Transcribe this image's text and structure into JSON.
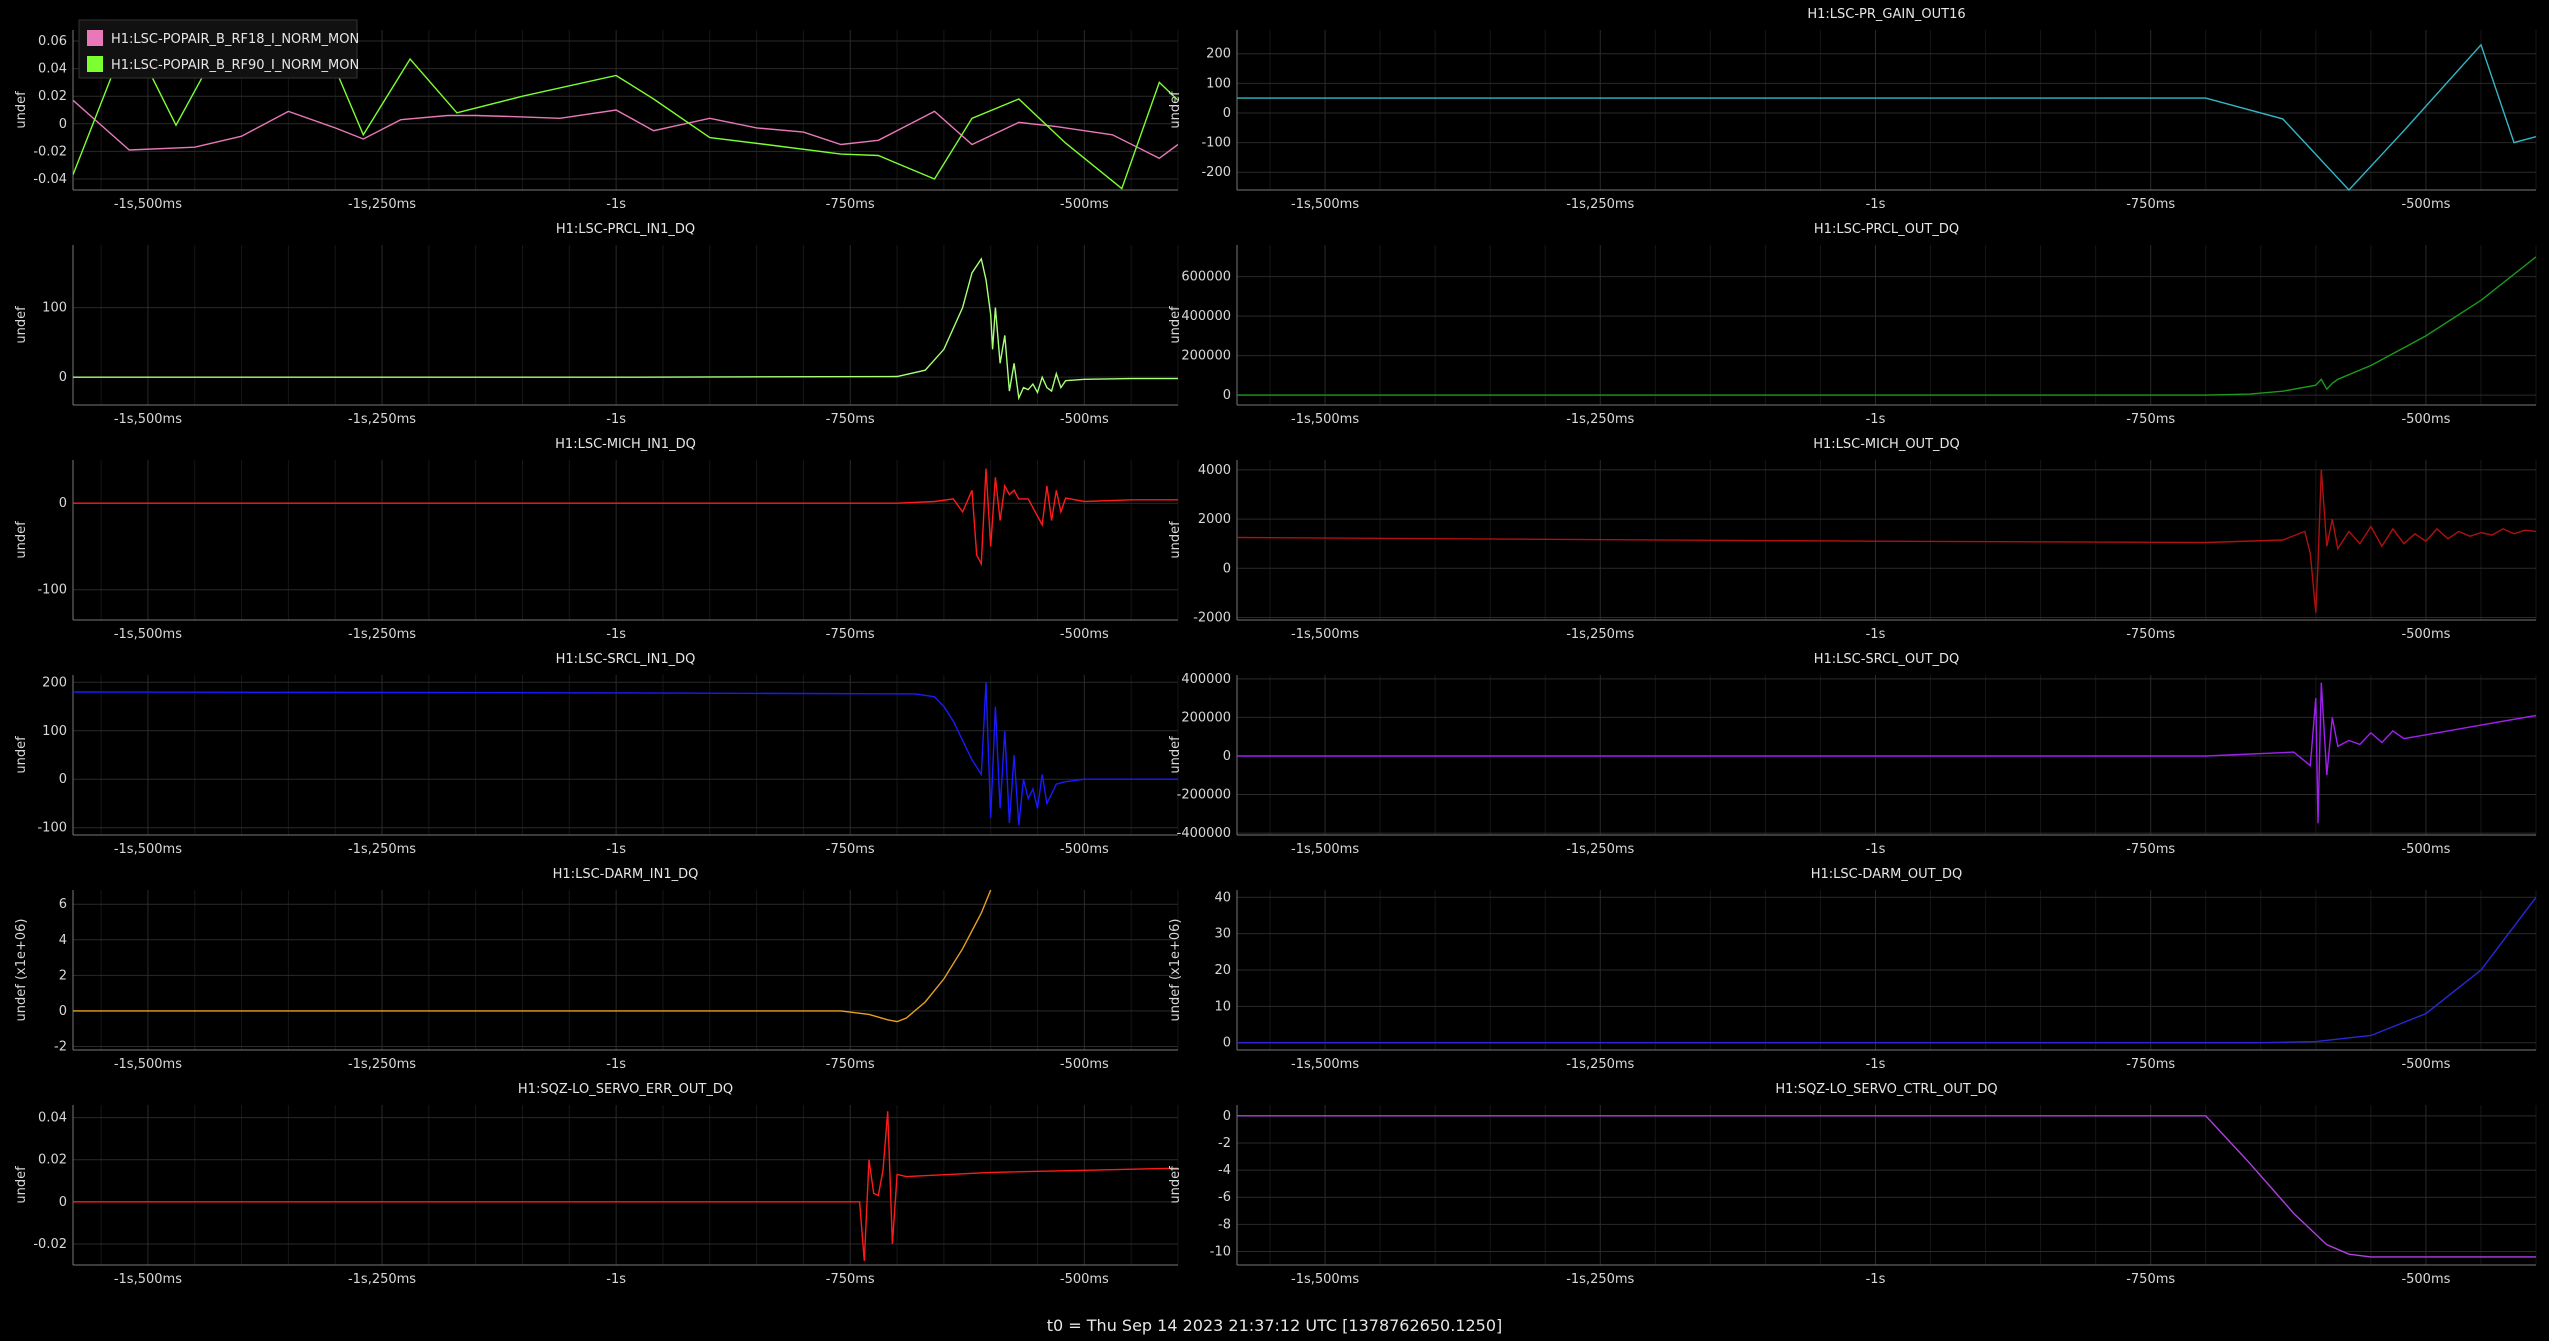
{
  "footer": "t0 = Thu Sep 14 2023 21:37:12 UTC [1378762650.1250]",
  "x_ticks": [
    {
      "v": -1.5,
      "label": "-1s,500ms"
    },
    {
      "v": -1.25,
      "label": "-1s,250ms"
    },
    {
      "v": -1.0,
      "label": "-1s"
    },
    {
      "v": -0.75,
      "label": "-750ms"
    },
    {
      "v": -0.5,
      "label": "-500ms"
    }
  ],
  "chart_data": [
    {
      "type": "line",
      "title": "",
      "ylabel": "undef",
      "xlim": [
        -1.58,
        -0.4
      ],
      "ylim": [
        -0.048,
        0.068
      ],
      "yticks": [
        {
          "v": 0.06,
          "label": "0.06"
        },
        {
          "v": 0.04,
          "label": "0.04"
        },
        {
          "v": 0.02,
          "label": "0.02"
        },
        {
          "v": 0,
          "label": "0"
        },
        {
          "v": -0.02,
          "label": "-0.02"
        },
        {
          "v": -0.04,
          "label": "-0.04"
        }
      ],
      "legend": "top-left",
      "series": [
        {
          "name": "H1:LSC-POPAIR_B_RF18_I_NORM_MON",
          "color": "#e878b8",
          "x": [
            -1.58,
            -1.52,
            -1.45,
            -1.4,
            -1.35,
            -1.3,
            -1.27,
            -1.23,
            -1.18,
            -1.15,
            -1.1,
            -1.06,
            -1.0,
            -0.96,
            -0.9,
            -0.85,
            -0.8,
            -0.76,
            -0.72,
            -0.66,
            -0.62,
            -0.57,
            -0.53,
            -0.47,
            -0.42,
            -0.4
          ],
          "y": [
            0.017,
            -0.019,
            -0.017,
            -0.009,
            0.009,
            -0.003,
            -0.011,
            0.003,
            0.006,
            0.006,
            0.005,
            0.004,
            0.01,
            -0.005,
            0.004,
            -0.003,
            -0.006,
            -0.015,
            -0.012,
            0.009,
            -0.015,
            0.001,
            -0.002,
            -0.008,
            -0.025,
            -0.015
          ]
        },
        {
          "name": "H1:LSC-POPAIR_B_RF90_I_NORM_MON",
          "color": "#7cff30",
          "x": [
            -1.58,
            -1.52,
            -1.47,
            -1.42,
            -1.35,
            -1.3,
            -1.27,
            -1.22,
            -1.17,
            -1.1,
            -1.0,
            -0.96,
            -0.9,
            -0.84,
            -0.76,
            -0.72,
            -0.66,
            -0.62,
            -0.57,
            -0.52,
            -0.46,
            -0.42,
            -0.4
          ],
          "y": [
            -0.037,
            0.067,
            -0.001,
            0.061,
            0.058,
            0.04,
            -0.008,
            0.047,
            0.008,
            0.02,
            0.035,
            0.018,
            -0.01,
            -0.015,
            -0.022,
            -0.023,
            -0.04,
            0.004,
            0.018,
            -0.014,
            -0.047,
            0.03,
            0.017
          ]
        }
      ]
    },
    {
      "type": "line",
      "title": "H1:LSC-PR_GAIN_OUT16",
      "ylabel": "undef",
      "xlim": [
        -1.58,
        -0.4
      ],
      "ylim": [
        -260,
        280
      ],
      "yticks": [
        {
          "v": 200,
          "label": "200"
        },
        {
          "v": 100,
          "label": "100"
        },
        {
          "v": 0,
          "label": "0"
        },
        {
          "v": -100,
          "label": "-100"
        },
        {
          "v": -200,
          "label": "-200"
        }
      ],
      "series": [
        {
          "name": "",
          "color": "#30b8c8",
          "x": [
            -1.58,
            -1.0,
            -0.7,
            -0.63,
            -0.57,
            -0.52,
            -0.45,
            -0.42,
            -0.4
          ],
          "y": [
            50,
            50,
            50,
            -20,
            -260,
            -60,
            230,
            -100,
            -80
          ]
        }
      ]
    },
    {
      "type": "line",
      "title": "H1:LSC-PRCL_IN1_DQ",
      "ylabel": "undef",
      "xlim": [
        -1.58,
        -0.4
      ],
      "ylim": [
        -40,
        190
      ],
      "yticks": [
        {
          "v": 100,
          "label": "100"
        },
        {
          "v": 0,
          "label": "0"
        }
      ],
      "series": [
        {
          "name": "",
          "color": "#a8ff78",
          "x": [
            -1.58,
            -1.0,
            -0.7,
            -0.67,
            -0.65,
            -0.63,
            -0.62,
            -0.61,
            -0.605,
            -0.6,
            -0.598,
            -0.595,
            -0.59,
            -0.585,
            -0.58,
            -0.575,
            -0.57,
            -0.565,
            -0.56,
            -0.555,
            -0.55,
            -0.545,
            -0.54,
            -0.535,
            -0.53,
            -0.525,
            -0.52,
            -0.5,
            -0.45,
            -0.4
          ],
          "y": [
            0,
            0,
            1,
            10,
            40,
            100,
            150,
            170,
            140,
            90,
            40,
            100,
            20,
            60,
            -20,
            20,
            -30,
            -15,
            -18,
            -10,
            -22,
            0,
            -15,
            -20,
            5,
            -15,
            -5,
            -3,
            -2,
            -2
          ]
        }
      ]
    },
    {
      "type": "line",
      "title": "H1:LSC-PRCL_OUT_DQ",
      "ylabel": "undef",
      "xlim": [
        -1.58,
        -0.4
      ],
      "ylim": [
        -50000,
        760000
      ],
      "yticks": [
        {
          "v": 600000,
          "label": "600000"
        },
        {
          "v": 400000,
          "label": "400000"
        },
        {
          "v": 200000,
          "label": "200000"
        },
        {
          "v": 0,
          "label": "0"
        }
      ],
      "series": [
        {
          "name": "",
          "color": "#1a9a1a",
          "x": [
            -1.58,
            -1.0,
            -0.7,
            -0.66,
            -0.63,
            -0.6,
            -0.595,
            -0.59,
            -0.585,
            -0.58,
            -0.55,
            -0.5,
            -0.45,
            -0.4
          ],
          "y": [
            0,
            0,
            0,
            5000,
            20000,
            50000,
            80000,
            30000,
            60000,
            80000,
            150000,
            300000,
            480000,
            700000
          ]
        }
      ]
    },
    {
      "type": "line",
      "title": "H1:LSC-MICH_IN1_DQ",
      "ylabel": "undef",
      "xlim": [
        -1.58,
        -0.4
      ],
      "ylim": [
        -135,
        50
      ],
      "yticks": [
        {
          "v": 0,
          "label": "0"
        },
        {
          "v": -100,
          "label": "-100"
        }
      ],
      "series": [
        {
          "name": "",
          "color": "#ff1a1a",
          "x": [
            -1.58,
            -1.0,
            -0.7,
            -0.66,
            -0.64,
            -0.63,
            -0.62,
            -0.615,
            -0.61,
            -0.605,
            -0.6,
            -0.595,
            -0.59,
            -0.585,
            -0.58,
            -0.575,
            -0.57,
            -0.56,
            -0.55,
            -0.545,
            -0.54,
            -0.535,
            -0.53,
            -0.525,
            -0.52,
            -0.5,
            -0.45,
            -0.4
          ],
          "y": [
            0,
            0,
            0,
            2,
            5,
            -10,
            15,
            -60,
            -70,
            40,
            -50,
            30,
            -20,
            20,
            10,
            15,
            5,
            5,
            -15,
            -25,
            20,
            -20,
            15,
            -10,
            6,
            2,
            4,
            4
          ]
        }
      ]
    },
    {
      "type": "line",
      "title": "H1:LSC-MICH_OUT_DQ",
      "ylabel": "undef",
      "xlim": [
        -1.58,
        -0.4
      ],
      "ylim": [
        -2100,
        4400
      ],
      "yticks": [
        {
          "v": 4000,
          "label": "4000"
        },
        {
          "v": 2000,
          "label": "2000"
        },
        {
          "v": 0,
          "label": "0"
        },
        {
          "v": -2000,
          "label": "-2000"
        }
      ],
      "series": [
        {
          "name": "",
          "color": "#b01010",
          "x": [
            -1.58,
            -1.0,
            -0.7,
            -0.63,
            -0.61,
            -0.605,
            -0.6,
            -0.598,
            -0.595,
            -0.59,
            -0.585,
            -0.58,
            -0.57,
            -0.56,
            -0.55,
            -0.54,
            -0.53,
            -0.52,
            -0.51,
            -0.5,
            -0.49,
            -0.48,
            -0.47,
            -0.46,
            -0.45,
            -0.44,
            -0.43,
            -0.42,
            -0.41,
            -0.4
          ],
          "y": [
            1250,
            1100,
            1050,
            1150,
            1500,
            600,
            -1800,
            200,
            4000,
            900,
            2000,
            800,
            1500,
            1000,
            1700,
            900,
            1600,
            1000,
            1400,
            1100,
            1600,
            1200,
            1500,
            1300,
            1450,
            1350,
            1600,
            1400,
            1550,
            1500
          ]
        }
      ]
    },
    {
      "type": "line",
      "title": "H1:LSC-SRCL_IN1_DQ",
      "ylabel": "undef",
      "xlim": [
        -1.58,
        -0.4
      ],
      "ylim": [
        -115,
        215
      ],
      "yticks": [
        {
          "v": 200,
          "label": "200"
        },
        {
          "v": 100,
          "label": "100"
        },
        {
          "v": 0,
          "label": "0"
        },
        {
          "v": -100,
          "label": "-100"
        }
      ],
      "series": [
        {
          "name": "",
          "color": "#1a1aff",
          "x": [
            -1.58,
            -1.0,
            -0.68,
            -0.66,
            -0.65,
            -0.64,
            -0.63,
            -0.62,
            -0.61,
            -0.605,
            -0.6,
            -0.595,
            -0.59,
            -0.585,
            -0.58,
            -0.575,
            -0.57,
            -0.565,
            -0.56,
            -0.555,
            -0.55,
            -0.545,
            -0.54,
            -0.53,
            -0.52,
            -0.5,
            -0.45,
            -0.4
          ],
          "y": [
            180,
            178,
            176,
            170,
            150,
            120,
            80,
            40,
            10,
            200,
            -80,
            150,
            -60,
            100,
            -90,
            50,
            -95,
            0,
            -40,
            -20,
            -60,
            10,
            -50,
            -10,
            -5,
            0,
            0,
            0
          ]
        }
      ]
    },
    {
      "type": "line",
      "title": "H1:LSC-SRCL_OUT_DQ",
      "ylabel": "undef",
      "xlim": [
        -1.58,
        -0.4
      ],
      "ylim": [
        -410000,
        420000
      ],
      "yticks": [
        {
          "v": 400000,
          "label": "400000"
        },
        {
          "v": 200000,
          "label": "200000"
        },
        {
          "v": 0,
          "label": "0"
        },
        {
          "v": -200000,
          "label": "-200000"
        },
        {
          "v": -400000,
          "label": "-400000"
        }
      ],
      "series": [
        {
          "name": "",
          "color": "#a020f0",
          "x": [
            -1.58,
            -1.0,
            -0.7,
            -0.62,
            -0.605,
            -0.6,
            -0.598,
            -0.595,
            -0.59,
            -0.585,
            -0.58,
            -0.57,
            -0.56,
            -0.55,
            -0.54,
            -0.53,
            -0.52,
            -0.5,
            -0.45,
            -0.4
          ],
          "y": [
            0,
            0,
            0,
            20000,
            -50000,
            300000,
            -350000,
            380000,
            -100000,
            200000,
            50000,
            80000,
            60000,
            120000,
            70000,
            130000,
            90000,
            110000,
            160000,
            210000
          ]
        }
      ]
    },
    {
      "type": "line",
      "title": "H1:LSC-DARM_IN1_DQ",
      "ylabel": "undef (x1e+06)",
      "xlim": [
        -1.58,
        -0.4
      ],
      "ylim": [
        -2.2,
        6.8
      ],
      "yticks": [
        {
          "v": 6,
          "label": "6"
        },
        {
          "v": 4,
          "label": "4"
        },
        {
          "v": 2,
          "label": "2"
        },
        {
          "v": 0,
          "label": "0"
        },
        {
          "v": -2,
          "label": "-2"
        }
      ],
      "series": [
        {
          "name": "",
          "color": "#e8a020",
          "x": [
            -1.58,
            -1.0,
            -0.76,
            -0.73,
            -0.71,
            -0.7,
            -0.69,
            -0.67,
            -0.65,
            -0.63,
            -0.61,
            -0.6
          ],
          "y": [
            0,
            0,
            0,
            -0.2,
            -0.5,
            -0.6,
            -0.4,
            0.5,
            1.8,
            3.5,
            5.5,
            6.8
          ]
        }
      ]
    },
    {
      "type": "line",
      "title": "H1:LSC-DARM_OUT_DQ",
      "ylabel": "undef (x1e+06)",
      "xlim": [
        -1.58,
        -0.4
      ],
      "ylim": [
        -2,
        42
      ],
      "yticks": [
        {
          "v": 40,
          "label": "40"
        },
        {
          "v": 30,
          "label": "30"
        },
        {
          "v": 20,
          "label": "20"
        },
        {
          "v": 10,
          "label": "10"
        },
        {
          "v": 0,
          "label": "0"
        }
      ],
      "series": [
        {
          "name": "",
          "color": "#2828d8",
          "x": [
            -1.58,
            -1.0,
            -0.65,
            -0.6,
            -0.55,
            -0.5,
            -0.45,
            -0.4
          ],
          "y": [
            0,
            0,
            0,
            0.3,
            2,
            8,
            20,
            40
          ]
        }
      ]
    },
    {
      "type": "line",
      "title": "H1:SQZ-LO_SERVO_ERR_OUT_DQ",
      "ylabel": "undef",
      "xlim": [
        -1.58,
        -0.4
      ],
      "ylim": [
        -0.03,
        0.046
      ],
      "yticks": [
        {
          "v": 0.04,
          "label": "0.04"
        },
        {
          "v": 0.02,
          "label": "0.02"
        },
        {
          "v": 0,
          "label": "0"
        },
        {
          "v": -0.02,
          "label": "-0.02"
        }
      ],
      "series": [
        {
          "name": "",
          "color": "#ff1a1a",
          "x": [
            -1.58,
            -1.0,
            -0.74,
            -0.735,
            -0.73,
            -0.725,
            -0.72,
            -0.715,
            -0.71,
            -0.705,
            -0.7,
            -0.69,
            -0.6,
            -0.5,
            -0.4
          ],
          "y": [
            0,
            0,
            0,
            -0.028,
            0.02,
            0.004,
            0.003,
            0.015,
            0.043,
            -0.02,
            0.013,
            0.012,
            0.014,
            0.015,
            0.016
          ]
        }
      ]
    },
    {
      "type": "line",
      "title": "H1:SQZ-LO_SERVO_CTRL_OUT_DQ",
      "ylabel": "undef",
      "xlim": [
        -1.58,
        -0.4
      ],
      "ylim": [
        -11,
        0.8
      ],
      "yticks": [
        {
          "v": 0,
          "label": "0"
        },
        {
          "v": -2,
          "label": "-2"
        },
        {
          "v": -4,
          "label": "-4"
        },
        {
          "v": -6,
          "label": "-6"
        },
        {
          "v": -8,
          "label": "-8"
        },
        {
          "v": -10,
          "label": "-10"
        }
      ],
      "series": [
        {
          "name": "",
          "color": "#b040e0",
          "x": [
            -1.58,
            -1.0,
            -0.7,
            -0.66,
            -0.62,
            -0.59,
            -0.57,
            -0.55,
            -0.5,
            -0.4
          ],
          "y": [
            0,
            0,
            0,
            -3.5,
            -7.2,
            -9.5,
            -10.2,
            -10.4,
            -10.4,
            -10.4
          ]
        }
      ]
    }
  ]
}
